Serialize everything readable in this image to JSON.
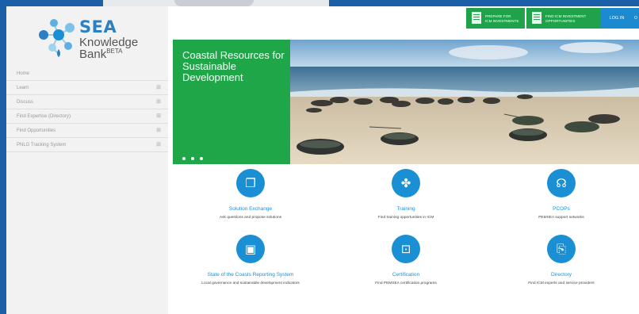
{
  "logo": {
    "sea": "SEA",
    "knowledge": "Knowledge",
    "bank": "Bank",
    "beta": "BETA"
  },
  "sidebar": {
    "items": [
      {
        "label": "Home",
        "expand": ""
      },
      {
        "label": "Learn",
        "expand": "⊞"
      },
      {
        "label": "Discuss",
        "expand": "⊞"
      },
      {
        "label": "Find Expertise (Directory)",
        "expand": "⊞"
      },
      {
        "label": "Find Opportunities",
        "expand": "⊞"
      },
      {
        "label": "PNLG Tracking System",
        "expand": "⊞"
      }
    ]
  },
  "topbar": {
    "prepare_line1": "PREPARE FOR",
    "prepare_line2": "ICM INVESTMENTS",
    "find_line1": "FIND ICM INVESTMENT",
    "find_line2": "OPPORTUNITIES",
    "login": "LOG IN",
    "extra": "O"
  },
  "hero": {
    "title": "Coastal Resources for Sustainable Development"
  },
  "colors": {
    "accent_blue": "#1b8fd4",
    "accent_green": "#1fa648",
    "frame_blue": "#1a5fa8"
  },
  "cards": [
    {
      "title": "Solution Exchange",
      "subtitle": "Ask questions and propose solutions",
      "icon": "documents-icon"
    },
    {
      "title": "Training",
      "subtitle": "Find training opportunities in ICM",
      "icon": "handshake-icon"
    },
    {
      "title": "PCOPs",
      "subtitle": "PEMSEA support networks",
      "icon": "people-network-icon"
    },
    {
      "title": "State of the Coasts Reporting System",
      "subtitle": "Local governance and sustainable development indicators",
      "icon": "report-window-icon"
    },
    {
      "title": "Certification",
      "subtitle": "Find PEMSEA certification programs",
      "icon": "certificate-icon"
    },
    {
      "title": "Directory",
      "subtitle": "Find ICM experts and service providers",
      "icon": "directory-search-icon"
    }
  ]
}
